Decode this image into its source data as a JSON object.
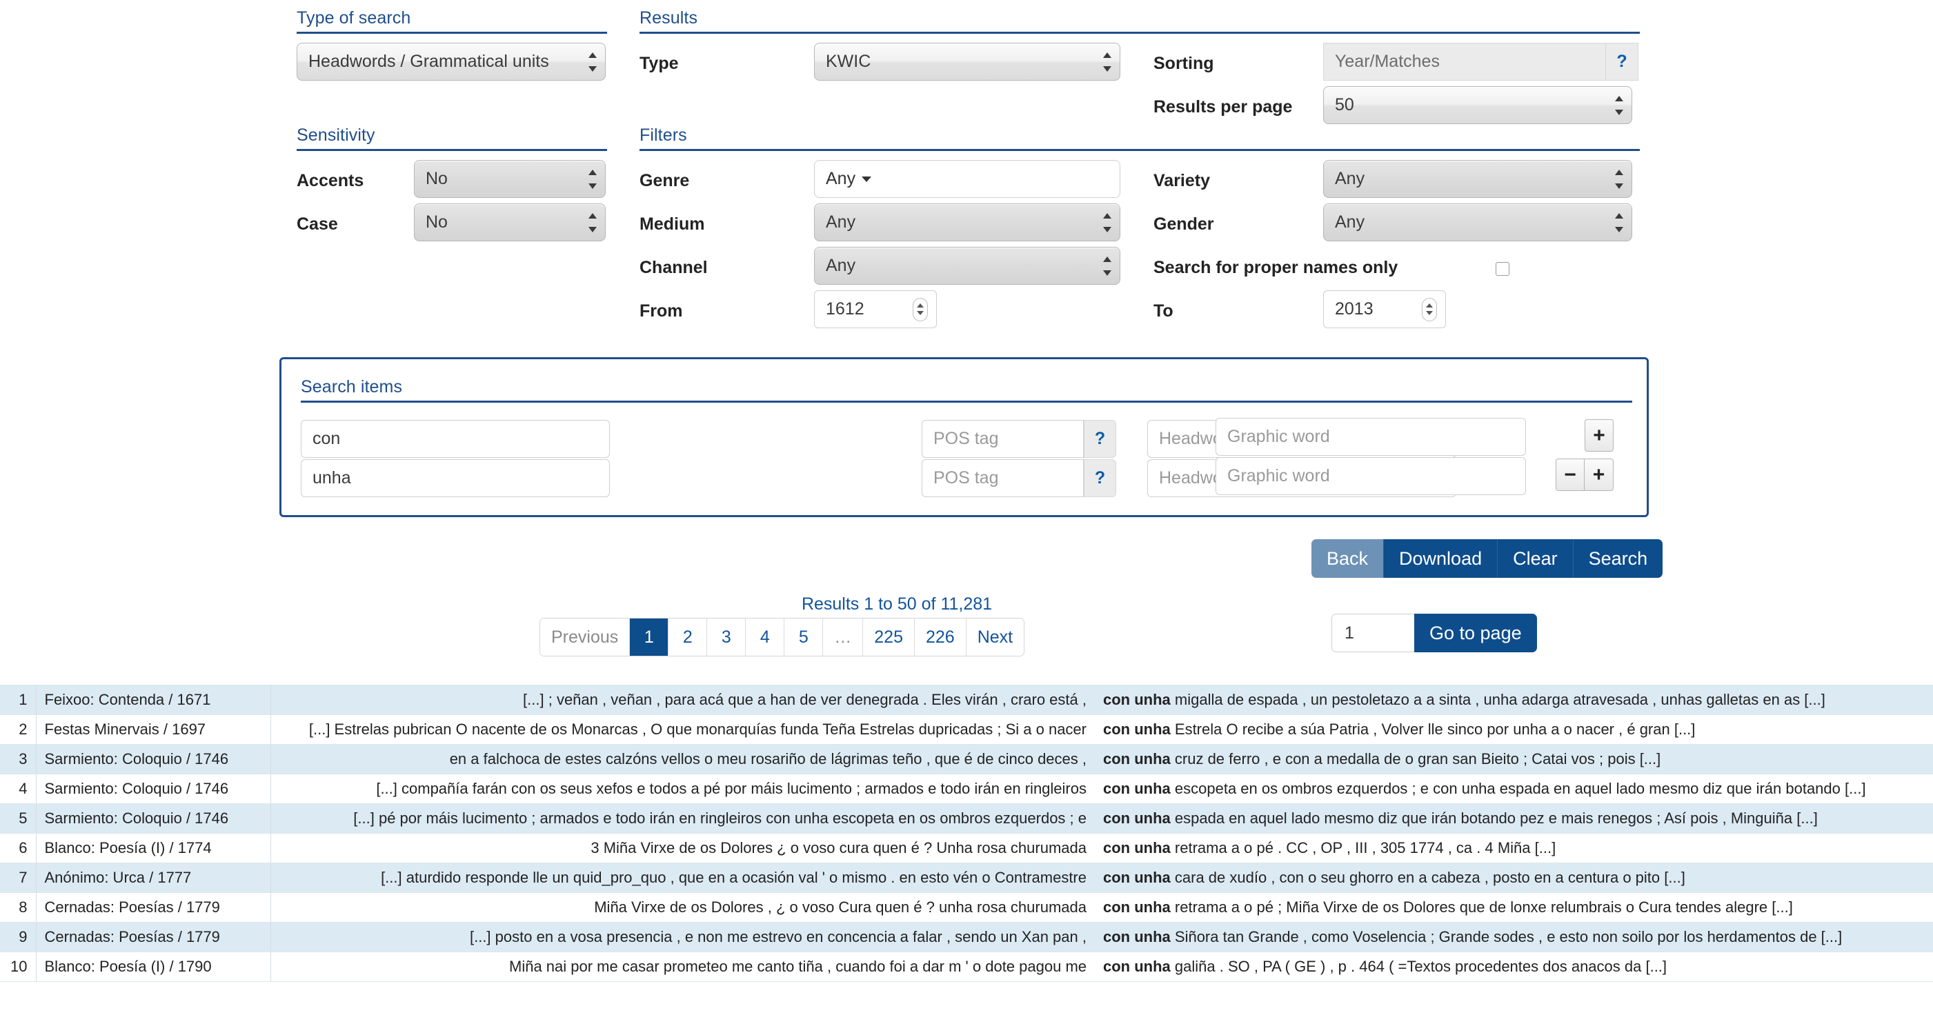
{
  "type_of_search": {
    "heading": "Type of search",
    "value": "Headwords / Grammatical units"
  },
  "sensitivity": {
    "heading": "Sensitivity",
    "accents_label": "Accents",
    "accents_value": "No",
    "case_label": "Case",
    "case_value": "No"
  },
  "results": {
    "heading": "Results",
    "type_label": "Type",
    "type_value": "KWIC",
    "sorting_label": "Sorting",
    "sorting_value": "Year/Matches",
    "sorting_help": "?",
    "per_page_label": "Results per page",
    "per_page_value": "50"
  },
  "filters": {
    "heading": "Filters",
    "genre_label": "Genre",
    "genre_value": "Any",
    "medium_label": "Medium",
    "medium_value": "Any",
    "channel_label": "Channel",
    "channel_value": "Any",
    "from_label": "From",
    "from_value": "1612",
    "variety_label": "Variety",
    "variety_value": "Any",
    "gender_label": "Gender",
    "gender_value": "Any",
    "proper_names_label": "Search for proper names only",
    "to_label": "To",
    "to_value": "2013"
  },
  "search_items": {
    "heading": "Search items",
    "help": "?",
    "add": "+",
    "remove": "−",
    "rows": [
      {
        "word": "con",
        "pos_placeholder": "POS tag",
        "headword_placeholder": "Headword",
        "graphic_placeholder": "Graphic word"
      },
      {
        "word": "unha",
        "pos_placeholder": "POS tag",
        "headword_placeholder": "Headword",
        "graphic_placeholder": "Graphic word"
      }
    ]
  },
  "actions": {
    "back": "Back",
    "download": "Download",
    "clear": "Clear",
    "search": "Search"
  },
  "pagination": {
    "results_count": "Results 1 to 50 of 11,281",
    "previous": "Previous",
    "next": "Next",
    "ellipsis": "…",
    "pages": [
      "1",
      "2",
      "3",
      "4",
      "5"
    ],
    "last_pages": [
      "225",
      "226"
    ],
    "active_page": "1",
    "goto_value": "1",
    "goto_label": "Go to page"
  },
  "table": {
    "keyword": "con unha",
    "rows": [
      {
        "n": "1",
        "ref": "Feixoo: Contenda / 1671",
        "left": "[...] ; veñan , veñan , para acá que a han de ver denegrada . Eles virán , craro está ,",
        "right": "migalla de espada , un pestoletazo a a sinta , unha adarga atravesada , unhas galletas en as [...]"
      },
      {
        "n": "2",
        "ref": "Festas Minervais / 1697",
        "left": "[...] Estrelas pubrican O nacente de os Monarcas , O que monarquías funda Teña Estrelas dupricadas ; Si a o nacer",
        "right": "Estrela O recibe a súa Patria , Volver lle sinco por unha a o nacer , é gran [...]"
      },
      {
        "n": "3",
        "ref": "Sarmiento: Coloquio / 1746",
        "left": "en a falchoca de estes calzóns vellos o meu rosariño de lágrimas teño , que é de cinco deces ,",
        "right": "cruz de ferro , e con a medalla de o gran san Bieito ; Catai vos ; pois [...]"
      },
      {
        "n": "4",
        "ref": "Sarmiento: Coloquio / 1746",
        "left": "[...] compañía farán con os seus xefos e todos a pé por máis lucimento ; armados e todo irán en ringleiros",
        "right": "escopeta en os ombros ezquerdos ; e con unha espada en aquel lado mesmo diz que irán botando [...]"
      },
      {
        "n": "5",
        "ref": "Sarmiento: Coloquio / 1746",
        "left": "[...] pé por máis lucimento ; armados e todo irán en ringleiros con unha escopeta en os ombros ezquerdos ; e",
        "right": "espada en aquel lado mesmo diz que irán botando pez e mais renegos ; Así pois , Minguiña [...]"
      },
      {
        "n": "6",
        "ref": "Blanco: Poesía (I) / 1774",
        "left": "3 Miña Virxe de os Dolores ¿ o voso cura quen é ? Unha rosa churumada",
        "right": "retrama a o pé . CC , OP , III , 305 1774 , ca . 4 Miña [...]"
      },
      {
        "n": "7",
        "ref": "Anónimo: Urca / 1777",
        "left": "[...] aturdido responde lle un quid_pro_quo , que en a ocasión val ' o mismo . en esto vén o Contramestre",
        "right": "cara de xudío , con o seu ghorro en a cabeza , posto en a centura o pito [...]"
      },
      {
        "n": "8",
        "ref": "Cernadas: Poesías / 1779",
        "left": "Miña Virxe de os Dolores , ¿ o voso Cura quen é ? unha rosa churumada",
        "right": "retrama a o pé ; Miña Virxe de os Dolores que de lonxe relumbrais o Cura tendes alegre [...]"
      },
      {
        "n": "9",
        "ref": "Cernadas: Poesías / 1779",
        "left": "[...] posto en a vosa presencia , e non me estrevo en concencia a falar , sendo un Xan pan ,",
        "right": "Siñora tan Grande , como Voselencia ; Grande sodes , e esto non soilo por los herdamentos de [...]"
      },
      {
        "n": "10",
        "ref": "Blanco: Poesía (I) / 1790",
        "left": "Miña nai por me casar prometeo me canto tiña , cuando foi a dar m ' o dote pagou me",
        "right": "galiña . SO , PA ( GE ) , p . 464 ( =Textos procedentes dos anacos da [...]"
      }
    ]
  }
}
